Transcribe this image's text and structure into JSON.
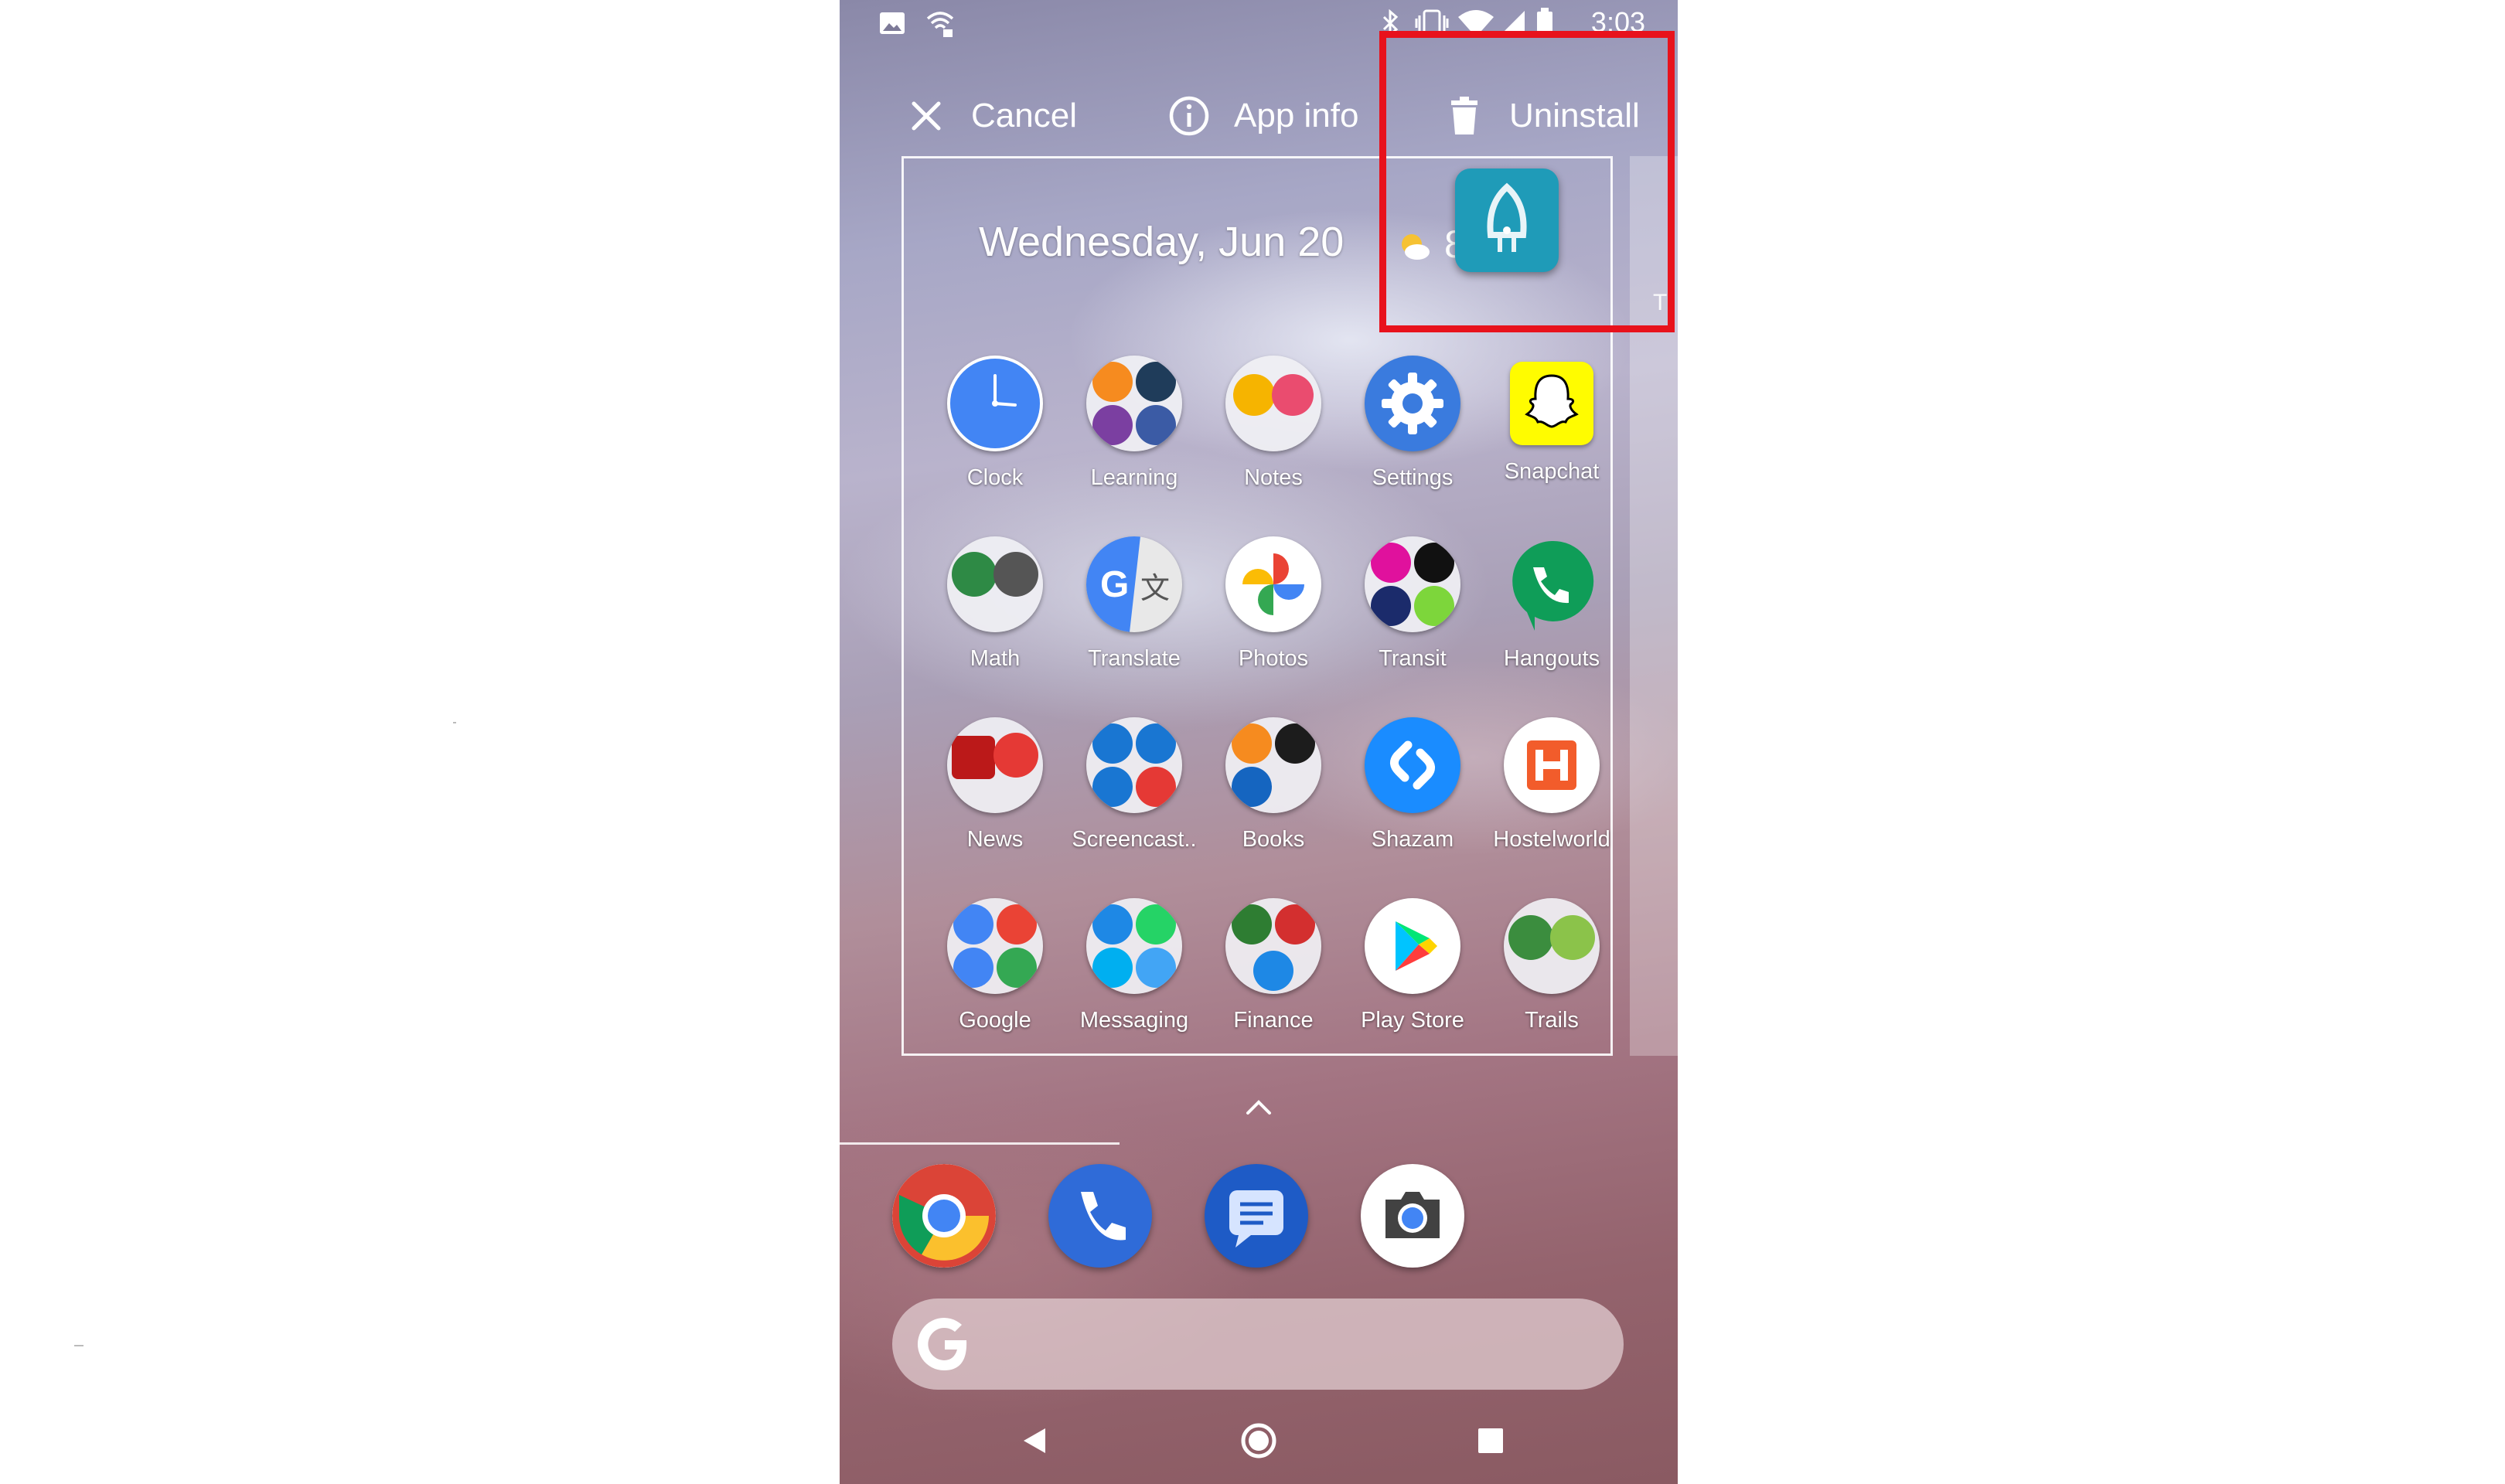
{
  "status_bar": {
    "time": "3:03",
    "left_icons": [
      "image-icon",
      "wifi-sync-icon"
    ],
    "right_icons": [
      "bluetooth-icon",
      "vibrate-icon",
      "wifi-icon",
      "cell-signal-icon",
      "battery-icon"
    ]
  },
  "drop_targets": {
    "cancel": {
      "label": "Cancel",
      "icon": "close-icon"
    },
    "app_info": {
      "label": "App info",
      "icon": "info-icon"
    },
    "uninstall": {
      "label": "Uninstall",
      "icon": "trash-icon"
    }
  },
  "home": {
    "date": "Wednesday, Jun 20",
    "weather_partial": "8",
    "next_page_partial": "T"
  },
  "apps": [
    {
      "label": "Clock"
    },
    {
      "label": "Learning"
    },
    {
      "label": "Notes"
    },
    {
      "label": "Settings"
    },
    {
      "label": "Snapchat"
    },
    {
      "label": "Math"
    },
    {
      "label": "Translate"
    },
    {
      "label": "Photos"
    },
    {
      "label": "Transit"
    },
    {
      "label": "Hangouts"
    },
    {
      "label": "News"
    },
    {
      "label": "Screencast.."
    },
    {
      "label": "Books"
    },
    {
      "label": "Shazam"
    },
    {
      "label": "Hostelworld"
    },
    {
      "label": "Google"
    },
    {
      "label": "Messaging"
    },
    {
      "label": "Finance"
    },
    {
      "label": "Play Store"
    },
    {
      "label": "Trails"
    }
  ],
  "dock": [
    "chrome-icon",
    "phone-icon",
    "messages-icon",
    "camera-icon"
  ],
  "colors": {
    "highlight": "#e8121c",
    "dragged_app": "#1f9bb8"
  }
}
